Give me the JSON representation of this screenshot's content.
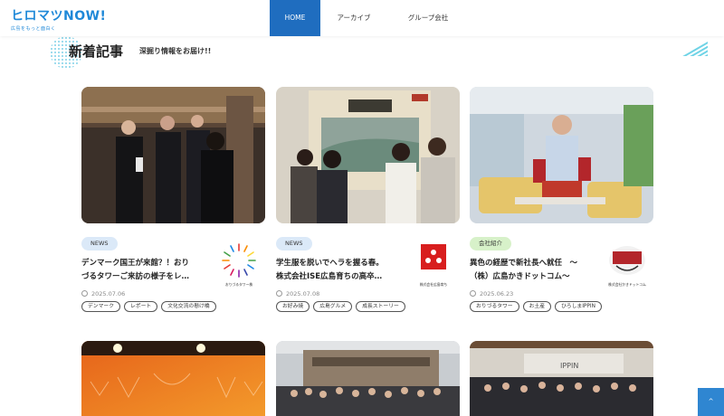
{
  "header": {
    "logo": "ヒロマツNOW!",
    "logo_sub": "広島をもっと面白く",
    "nav": [
      "HOME",
      "アーカイブ",
      "グループ会社"
    ]
  },
  "section": {
    "title": "新着記事",
    "subtitle": "深掘り情報をお届け!!"
  },
  "cards": [
    {
      "badge": "NEWS",
      "title_line1": "デンマーク国王が来館？！おり",
      "title_line2": "づるタワーご来訪の様子をレ…",
      "brand_label": "おりづるタワー株",
      "date": "2025.07.06",
      "tags": [
        "デンマーク",
        "レポート",
        "文化交流の懸け橋"
      ]
    },
    {
      "badge": "NEWS",
      "title_line1": "学生服を脱いでヘラを握る春。",
      "title_line2": "株式会社ISE広島育ちの高卒…",
      "brand_label": "株式会社広島育ち",
      "date": "2025.07.08",
      "tags": [
        "お好み焼",
        "広島グルメ",
        "成長ストーリー"
      ]
    },
    {
      "badge": "会社紹介",
      "title_line1": "異色の経歴で新社長へ就任　～",
      "title_line2": "（株）広島かきドットコム～",
      "brand_label": "株式会社かきドットコム",
      "date": "2025.06.23",
      "tags": [
        "おりづるタワー",
        "お土産",
        "ひろしまIPPIN"
      ]
    }
  ],
  "scroll_top": "^",
  "colors": {
    "accent": "#1f6dbf",
    "news_badge": "#dbe9f8",
    "company_badge": "#d7f1c9"
  }
}
